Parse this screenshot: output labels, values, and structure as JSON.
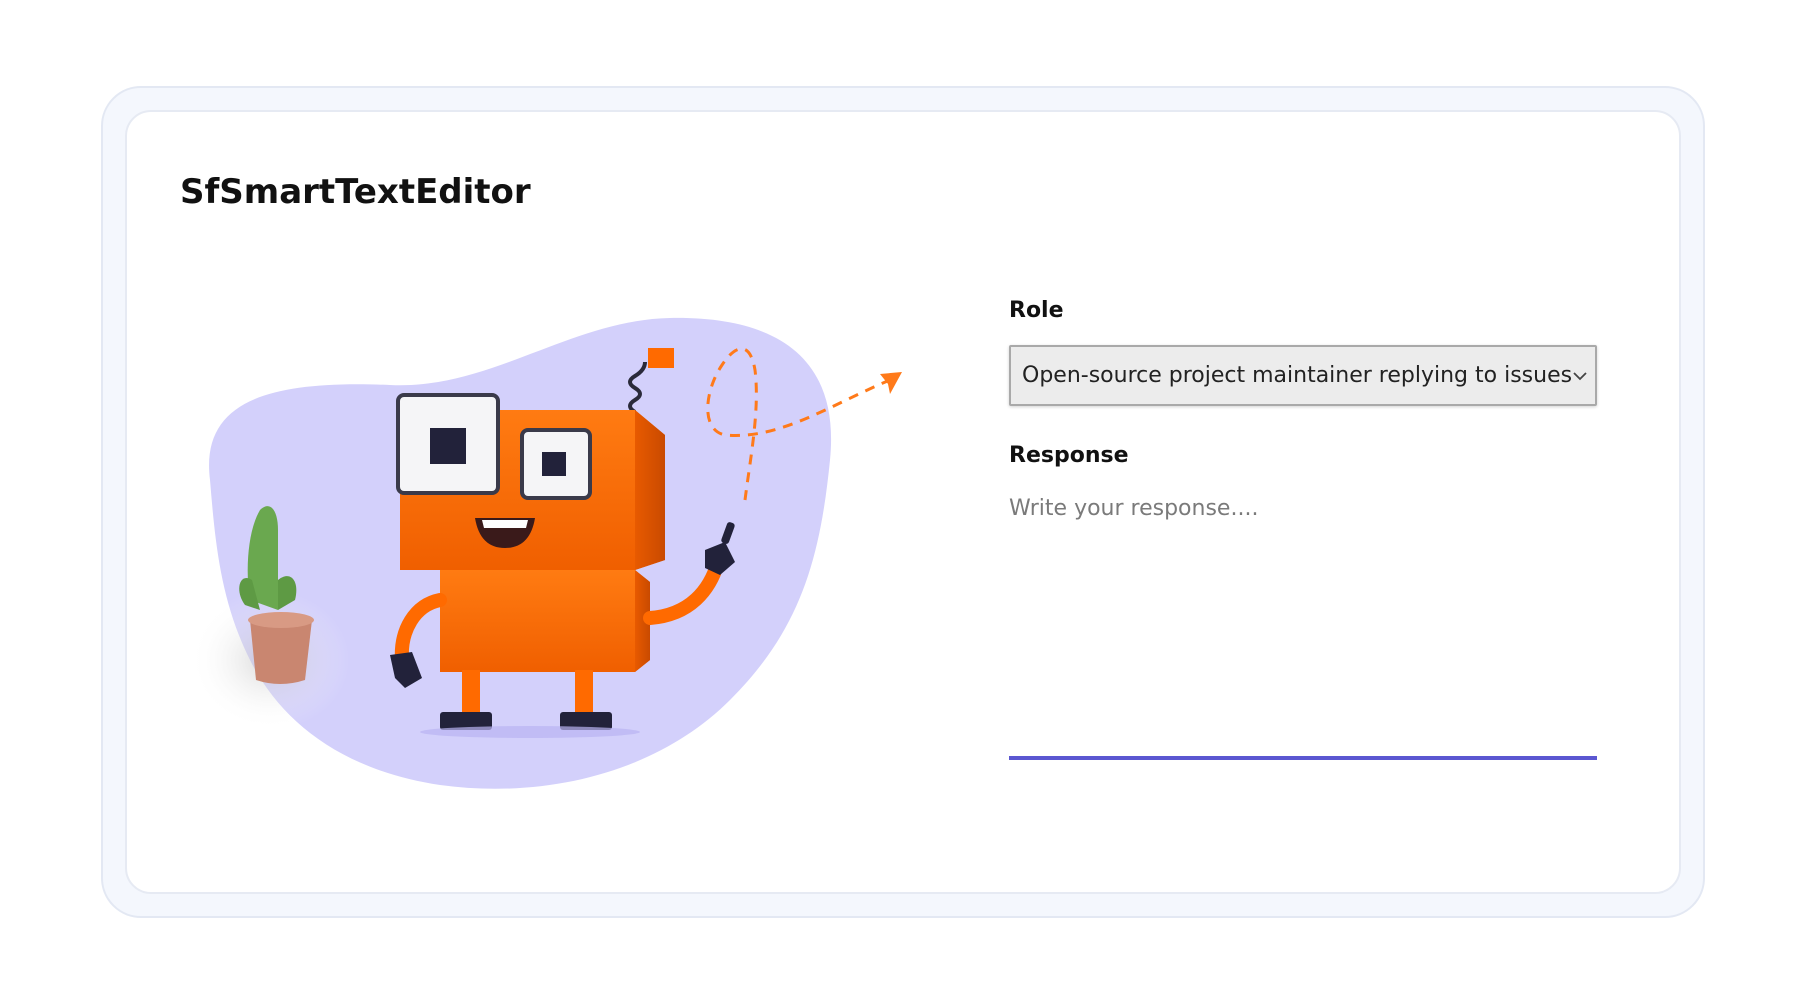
{
  "header": {
    "title": "SfSmartTextEditor"
  },
  "form": {
    "role_label": "Role",
    "role_value": "Open-source project maintainer replying to issues",
    "response_label": "Response",
    "response_placeholder": "Write your response....",
    "response_value": ""
  },
  "illustration": {
    "icon": "robot-mascot-illustration",
    "blob_color": "#d3d0fb",
    "robot_color": "#ff6a00",
    "dash_color": "#ff7a1a"
  },
  "theme": {
    "accent": "#5b57d1",
    "select_bg": "#ececec"
  }
}
